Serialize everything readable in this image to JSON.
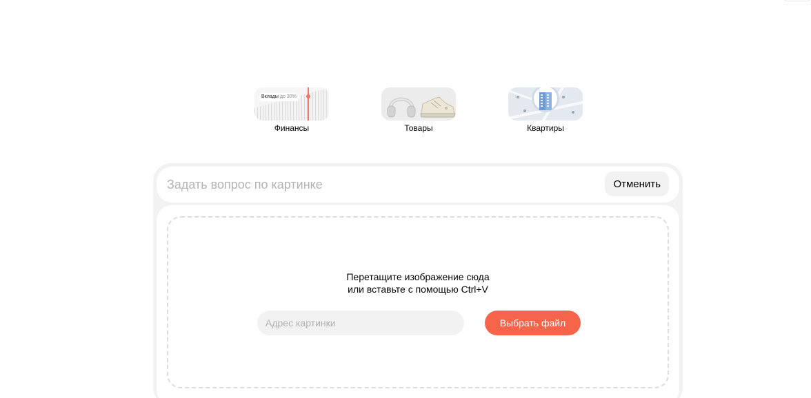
{
  "categories": [
    {
      "label": "Финансы",
      "thumb": {
        "pill_main": "Вклады",
        "pill_sub": "до 30%"
      }
    },
    {
      "label": "Товары"
    },
    {
      "label": "Квартиры"
    }
  ],
  "query": {
    "placeholder": "Задать вопрос по картинке",
    "cancel_label": "Отменить"
  },
  "upload": {
    "drop_line1": "Перетащите изображение сюда",
    "drop_line2": "или вставьте с помощью Ctrl+V",
    "url_placeholder": "Адрес картинки",
    "choose_label": "Выбрать файл"
  },
  "colors": {
    "accent": "#f6644a",
    "panel_bg": "#f2f2f2",
    "finance_line": "#f0776b"
  }
}
